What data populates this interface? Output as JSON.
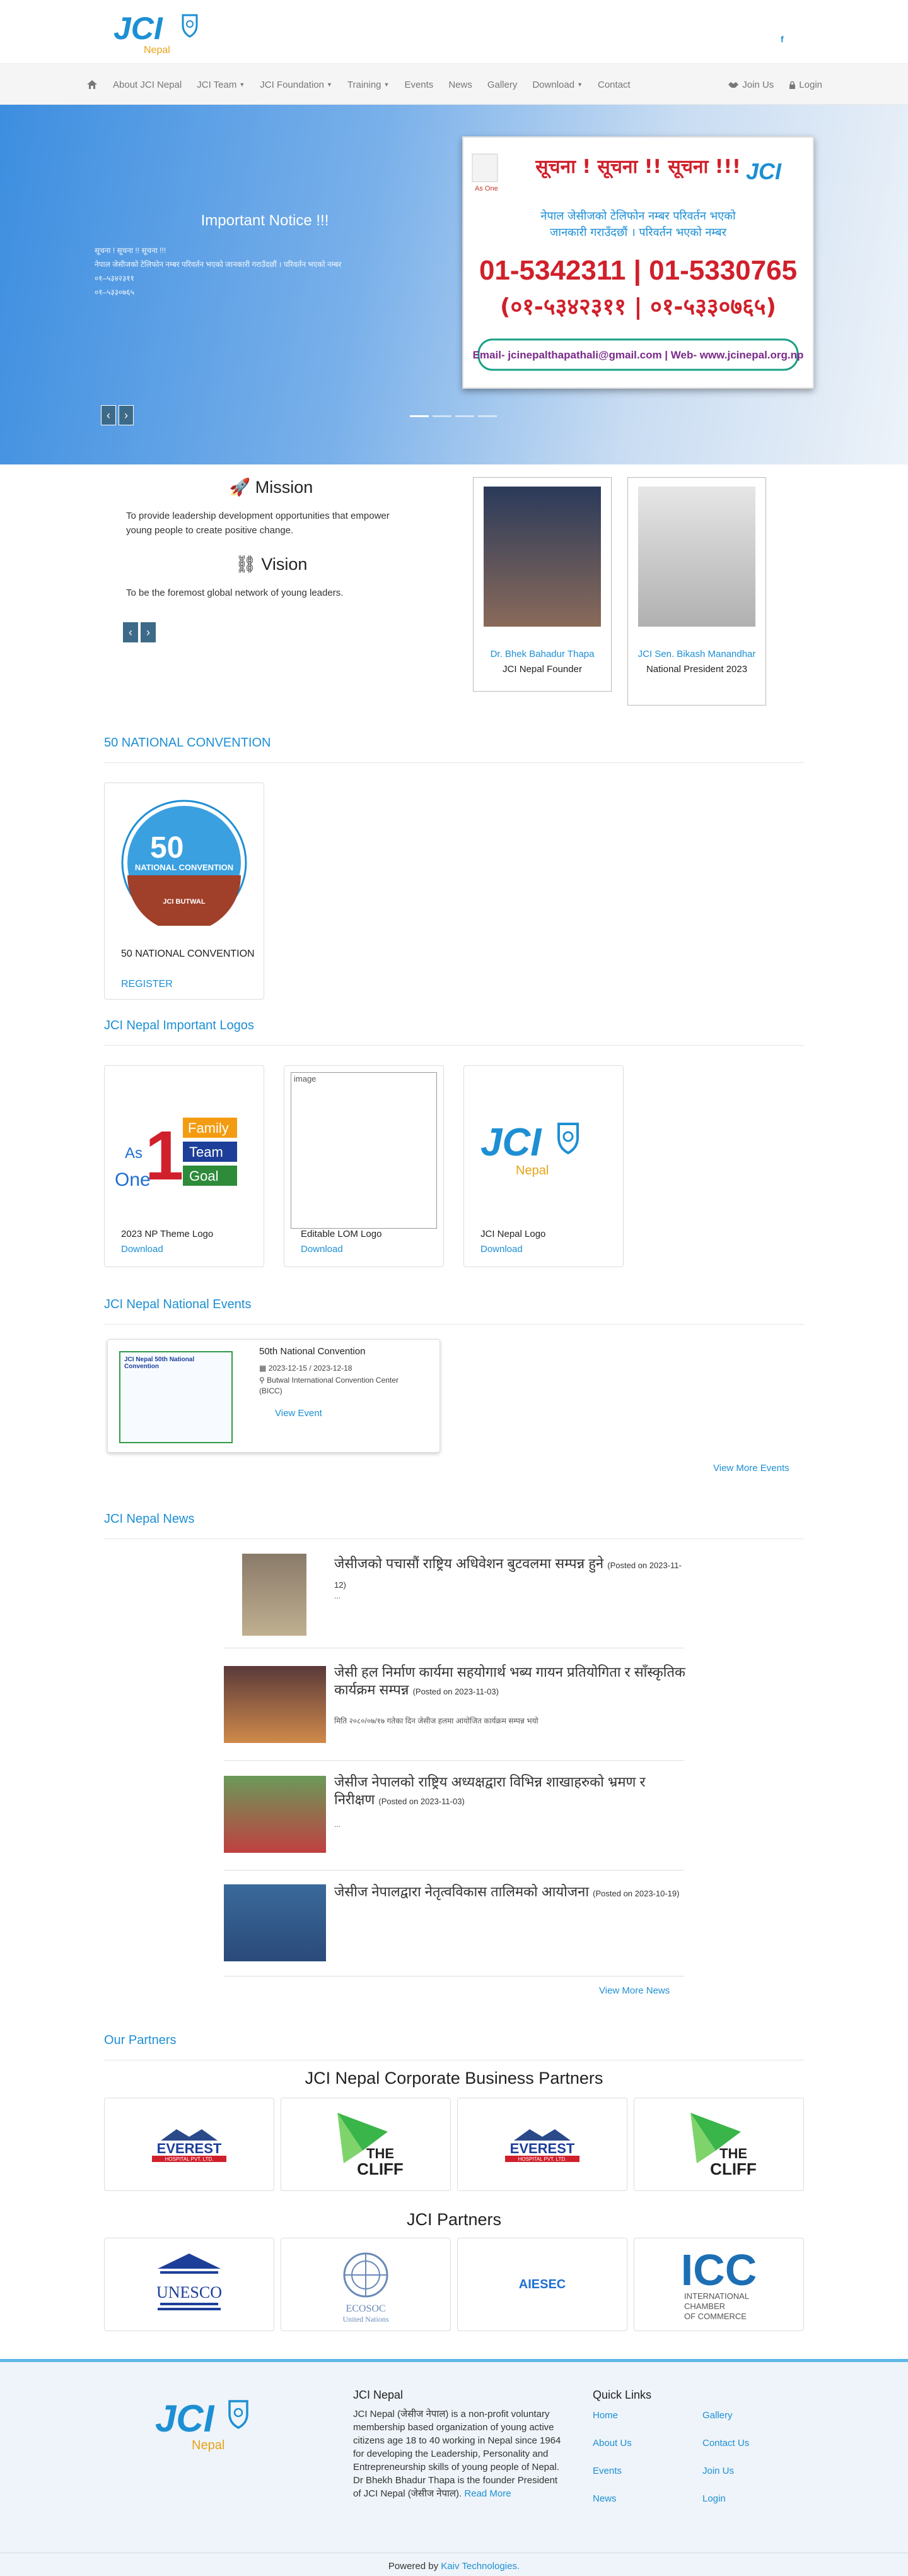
{
  "brand": {
    "logo_text": "JCI",
    "logo_sub": "Nepal",
    "accent": "#1d8fd4",
    "gold": "#e8a317"
  },
  "social": {
    "facebook": "f"
  },
  "nav": {
    "items": [
      {
        "label": "About JCI Nepal",
        "dropdown": false
      },
      {
        "label": "JCI Team",
        "dropdown": true
      },
      {
        "label": "JCI Foundation",
        "dropdown": true
      },
      {
        "label": "Training",
        "dropdown": true
      },
      {
        "label": "Events",
        "dropdown": false
      },
      {
        "label": "News",
        "dropdown": false
      },
      {
        "label": "Gallery",
        "dropdown": false
      },
      {
        "label": "Download",
        "dropdown": true
      },
      {
        "label": "Contact",
        "dropdown": false
      }
    ],
    "join": "Join Us",
    "login": "Login"
  },
  "hero": {
    "title": "Important Notice !!!",
    "lines": [
      "सूचना ! सूचना !! सूचना !!!",
      "नेपाल जेसीजको टेलिफोन नम्बर परिवर्तन भएको जानकारी गराउँदछौं । परिवर्तन भएको नम्बर",
      "०१–५३४२३११",
      "०१–५३३०७६५"
    ],
    "notice": {
      "heading": "सूचना ! सूचना !! सूचना !!!",
      "sub1": "नेपाल जेसीजको टेलिफोन नम्बर परिवर्तन भएको",
      "sub2": "जानकारी गराउँदछौं । परिवर्तन भएको नम्बर",
      "phones_en": "01-5342311 | 01-5330765",
      "phones_np": "(०१-५३४२३११ | ०१-५३३०७६५)",
      "email": "Email- jcinepalthapathali@gmail.com | Web- www.jcinepal.org.np",
      "badge": "As One"
    }
  },
  "mission": {
    "title": "Mission",
    "text": "To provide leadership development opportunities that empower young people to create positive change."
  },
  "vision": {
    "title": "Vision",
    "text": "To be the foremost global network of young leaders."
  },
  "people": [
    {
      "name": "Dr. Bhek Bahadur Thapa",
      "role": "JCI Nepal Founder"
    },
    {
      "name": "JCI Sen. Bikash Manandhar",
      "role": "National President 2023"
    }
  ],
  "convention_section": {
    "title": "50 NATIONAL CONVENTION",
    "card_title": "50 NATIONAL CONVENTION",
    "register": "REGISTER",
    "badge_text": "50",
    "badge_sub": "NATIONAL CONVENTION",
    "badge_host": "JCI BUTWAL"
  },
  "logos_section": {
    "title": "JCI Nepal Important Logos",
    "items": [
      {
        "caption": "2023 NP Theme Logo",
        "link": "Download"
      },
      {
        "caption": "Editable LOM Logo",
        "link": "Download",
        "alt": "image"
      },
      {
        "caption": "JCI Nepal Logo",
        "link": "Download"
      }
    ],
    "theme": {
      "as": "As",
      "one": "One",
      "w1": "Family",
      "w2": "Team",
      "w3": "Goal"
    }
  },
  "events_section": {
    "title": "JCI Nepal National Events",
    "event": {
      "name": "50th National Convention",
      "dates": "2023-12-15 / 2023-12-18",
      "venue": "Butwal International Convention Center (BICC)",
      "link": "View Event",
      "poster": "JCI Nepal 50th National Convention"
    },
    "more": "View More Events"
  },
  "news_section": {
    "title": "JCI Nepal News",
    "items": [
      {
        "title": "जेसीजको पचासौं राष्ट्रिय अधिवेशन बुटवलमा सम्पन्न हुने",
        "posted": "(Posted on 2023-11-12)",
        "excerpt": "..."
      },
      {
        "title": "जेसी हल निर्माण कार्यमा सहयोगार्थ भब्य गायन प्रतियोगिता र साँस्कृतिक कार्यक्रम सम्पन्न",
        "posted": "(Posted on 2023-11-03)",
        "excerpt": "मिति २०८०/०७/१७ गतेका दिन जेसीज हलमा आयोजित कार्यक्रम सम्पन्न भयो"
      },
      {
        "title": "जेसीज नेपालको राष्ट्रिय अध्यक्षद्वारा विभिन्न शाखाहरुको भ्रमण र निरीक्षण",
        "posted": "(Posted on 2023-11-03)",
        "excerpt": "..."
      },
      {
        "title": "जेसीज नेपालद्वारा नेतृत्वविकास तालिमको आयोजना",
        "posted": "(Posted on 2023-10-19)",
        "excerpt": ""
      }
    ],
    "more": "View More News"
  },
  "partners_section": {
    "title": "Our Partners",
    "corporate_title": "JCI Nepal Corporate Business Partners",
    "corporate": [
      {
        "line1": "EVEREST",
        "line2": "HOSPITAL PVT. LTD."
      },
      {
        "line1": "THE",
        "line2": "CLIFF"
      },
      {
        "line1": "EVEREST",
        "line2": "HOSPITAL PVT. LTD."
      },
      {
        "line1": "THE",
        "line2": "CLIFF"
      }
    ],
    "jci_title": "JCI Partners",
    "jci": [
      {
        "name": "UNESCO"
      },
      {
        "name": "ECOSOC",
        "sub": "United Nations"
      },
      {
        "name": "AIESEC"
      },
      {
        "name": "ICC",
        "sub1": "INTERNATIONAL",
        "sub2": "CHAMBER",
        "sub3": "OF COMMERCE"
      }
    ]
  },
  "footer": {
    "about_title": "JCI Nepal",
    "about_text": "JCI Nepal (जेसीज नेपाल) is a non-profit voluntary membership based organization of young active citizens age 18 to 40 working in Nepal since 1964 for developing the Leadership, Personality and Entrepreneurship skills of young people of Nepal. Dr Bhekh Bhadur Thapa is the founder President of JCI Nepal (जेसीज नेपाल).",
    "read_more": "Read More",
    "links_title": "Quick Links",
    "links": [
      "Home",
      "Gallery",
      "About Us",
      "Contact Us",
      "Events",
      "Join Us",
      "News",
      "Login"
    ],
    "powered": "Powered by",
    "powered_by": "Kaiv Technologies."
  }
}
